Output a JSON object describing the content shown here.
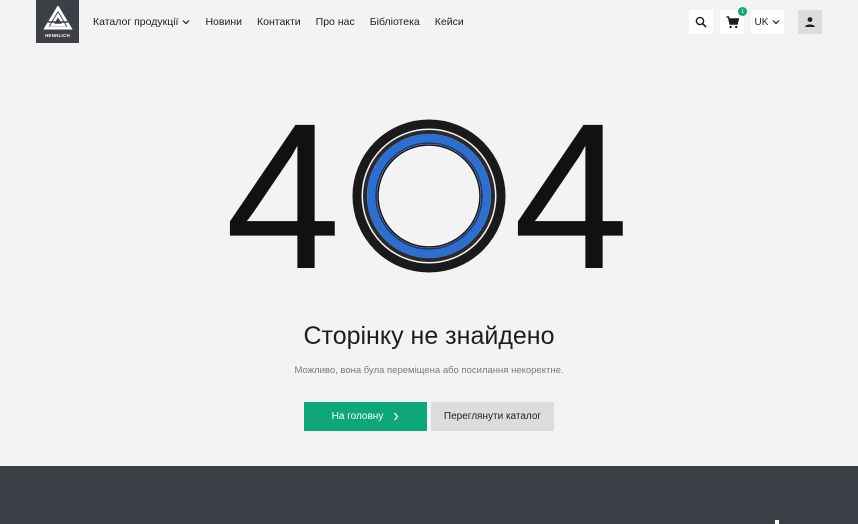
{
  "brand": {
    "logo_text": "HENNLICH"
  },
  "nav": {
    "items": [
      {
        "label": "Каталог продукції",
        "has_dropdown": true
      },
      {
        "label": "Новини"
      },
      {
        "label": "Контакти"
      },
      {
        "label": "Про нас"
      },
      {
        "label": "Бібліотека"
      },
      {
        "label": "Кейси"
      }
    ]
  },
  "header_actions": {
    "cart_count": "1",
    "language": "UK"
  },
  "error": {
    "code_left": "4",
    "code_right": "4",
    "title": "Сторінку не знайдено",
    "message": "Можливо, вона була переміщена або посилання некоректне."
  },
  "buttons": {
    "home_label": "На головну",
    "catalog_label": "Переглянути каталог"
  },
  "colors": {
    "accent": "#0ea77a",
    "dark": "#3b3e45",
    "background": "#f3f3f3",
    "ring_blue": "#2d6fd0"
  },
  "icons": {
    "search": "search-icon",
    "cart": "cart-icon",
    "user": "user-icon",
    "chevron": "chevron-down-icon",
    "arrow": "chevron-right-icon"
  }
}
